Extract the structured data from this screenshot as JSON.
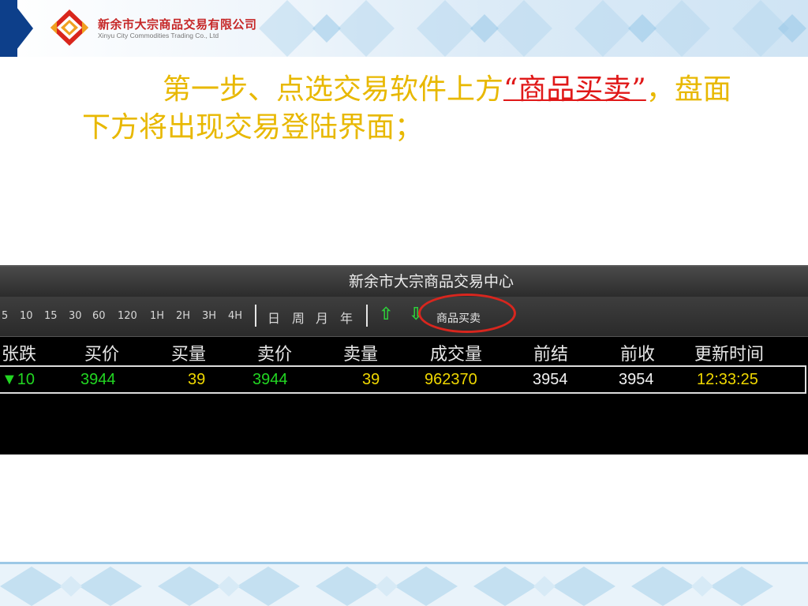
{
  "header": {
    "company_cn": "新余市大宗商品交易有限公司",
    "company_en": "Xinyu City Commodities Trading Co., Ltd"
  },
  "instruction": {
    "part1": "第一步、点选交易软件上方",
    "highlight": "“商品买卖”",
    "part2": "，盘面下方将出现交易登陆界面；"
  },
  "app": {
    "title": "新余市大宗商品交易中心",
    "toolbar": {
      "periods": [
        "5",
        "10",
        "15",
        "30",
        "60",
        "120",
        "1H",
        "2H",
        "3H",
        "4H"
      ],
      "day": "日",
      "week": "周",
      "month": "月",
      "year": "年",
      "commodity_trade": "商品买卖"
    },
    "columns": [
      "张跌",
      "买价",
      "买量",
      "卖价",
      "卖量",
      "成交量",
      "前结",
      "前收",
      "更新时间"
    ],
    "row": {
      "change": "▼10",
      "bid": "3944",
      "bid_vol": "39",
      "ask": "3944",
      "ask_vol": "39",
      "volume": "962370",
      "prev_settle": "3954",
      "prev_close": "3954",
      "update_time": "12:33:25"
    }
  },
  "colors": {
    "instruction_text": "#e8b800",
    "highlight_text": "#e01818",
    "bid_green": "#22d622",
    "vol_yellow": "#f0d800",
    "ellipse_red": "#d8261e",
    "header_blue": "#0d3f8a"
  }
}
